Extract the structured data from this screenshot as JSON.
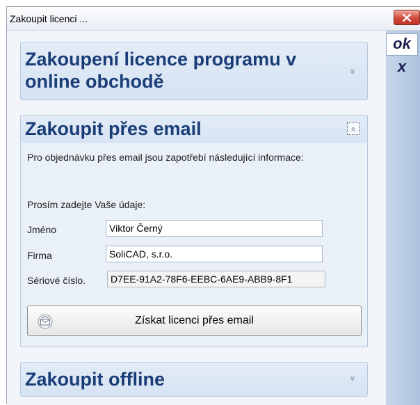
{
  "window": {
    "title": "Zakoupit licenci ..."
  },
  "sidebar": {
    "ok_label": "ok",
    "cancel_label": "x"
  },
  "sections": {
    "online": {
      "title_line1": "Zakoupení licence programu v",
      "title_line2": "online obchodě",
      "expanded": false
    },
    "email": {
      "title": "Zakoupit přes email",
      "expanded": true,
      "info_text": "Pro objednávku přes email jsou zapotřebí následující informace:",
      "prompt": "Prosím zadejte Vaše údaje:",
      "fields": {
        "name_label": "Jméno",
        "name_value": "Viktor Černý",
        "company_label": "Firma",
        "company_value": "SoliCAD, s.r.o.",
        "serial_label": "Sériové číslo.",
        "serial_value": "D7EE-91A2-78F6-EEBC-6AE9-ABB9-8F1"
      },
      "button_label": "Získat licenci přes email"
    },
    "offline": {
      "title": "Zakoupit offline",
      "expanded": false
    }
  },
  "icons": {
    "close": "close-icon",
    "expand": "double-chevron-down-icon",
    "collapse": "double-chevron-up-icon",
    "email": "envelope-icon"
  },
  "colors": {
    "section_title": "#1a3d77",
    "close_button": "#d0493a",
    "sidebar": "#aec4de"
  }
}
